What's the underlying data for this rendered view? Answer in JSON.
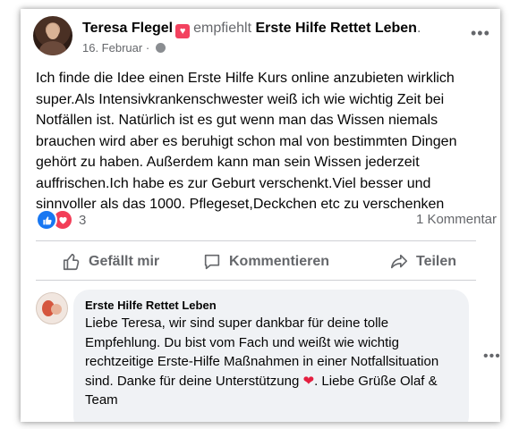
{
  "post": {
    "author": "Teresa Flegel",
    "verb": "empfiehlt",
    "page": "Erste Hilfe Rettet Leben",
    "page_suffix": ".",
    "date": "16. Februar",
    "date_sep": "·",
    "text": "Ich finde die Idee einen Erste Hilfe Kurs online anzubieten wirklich super.Als Intensivkrankenschwester weiß ich wie wichtig Zeit bei Notfällen ist. Natürlich ist es gut wenn man das Wissen niemals brauchen wird aber es beruhigt schon mal von bestimmten Dingen gehört zu haben. Außerdem kann man sein Wissen jederzeit auffrischen.Ich habe es zur Geburt verschenkt.Viel besser und sinnvoller als das 1000. Pflegeset,Deckchen etc zu verschenken",
    "reaction_count": "3",
    "comment_count": "1 Kommentar"
  },
  "actions": {
    "like": "Gefällt mir",
    "comment": "Kommentieren",
    "share": "Teilen"
  },
  "comment": {
    "author": "Erste Hilfe Rettet Leben",
    "text_before_heart": "Liebe Teresa, wir sind super dankbar für deine tolle Empfehlung. Du bist vom Fach und weißt wie wichtig rechtzeitige Erste-Hilfe Maßnahmen in einer Notfallsituation sind. Danke für deine Unterstützung ",
    "heart": "❤",
    "text_after_heart": ". Liebe Grüße Olaf & Team"
  },
  "icons": {
    "more": "more-horizontal-icon",
    "globe": "globe-icon",
    "like": "thumbs-up-icon",
    "comment": "comment-bubble-icon",
    "share": "share-arrow-icon",
    "recommend": "recommend-heart-badge-icon"
  },
  "colors": {
    "like_blue": "#1877f2",
    "love_red": "#f33e58",
    "secondary_text": "#65676b",
    "comment_bg": "#f0f2f5"
  }
}
